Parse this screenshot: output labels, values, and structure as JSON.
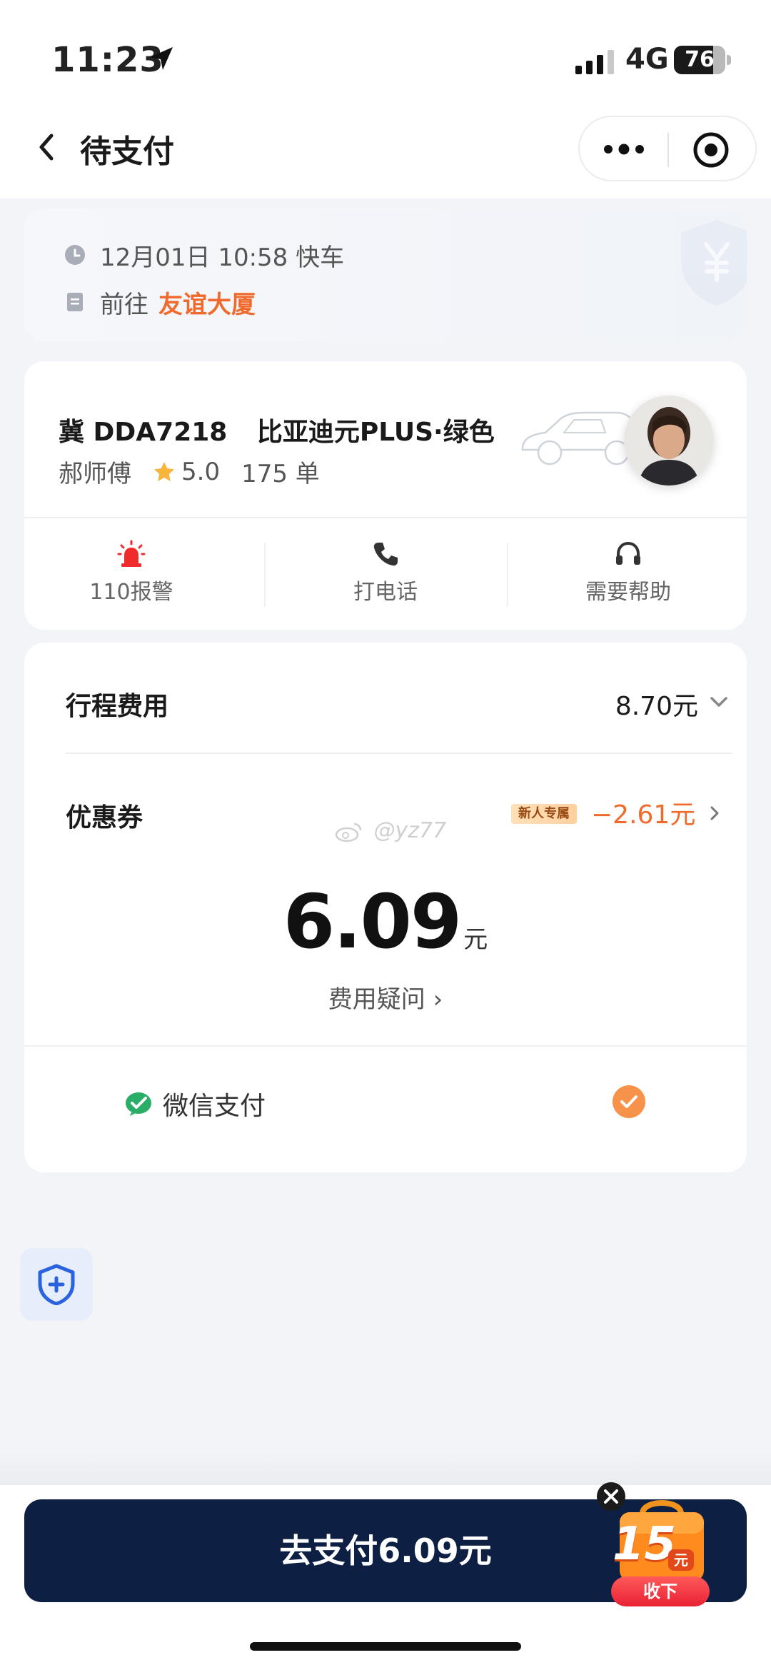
{
  "status_bar": {
    "time": "11:23",
    "network": "4G",
    "battery": "76",
    "battery_level": 0.76
  },
  "nav": {
    "title": "待支付"
  },
  "trip": {
    "datetime": "12月01日 10:58 快车",
    "dest_prefix": "前往",
    "destination": "友谊大厦"
  },
  "driver": {
    "plate": "冀 DDA7218",
    "car_model": "比亚迪元PLUS·绿色",
    "name": "郝师傅",
    "rating": "5.0",
    "orders": "175 单",
    "actions": [
      {
        "label": "110报警",
        "icon": "alarm-icon"
      },
      {
        "label": "打电话",
        "icon": "phone-icon"
      },
      {
        "label": "需要帮助",
        "icon": "headset-icon"
      }
    ]
  },
  "fee": {
    "trip_fee_label": "行程费用",
    "trip_fee_value": "8.70元",
    "coupon_label": "优惠券",
    "coupon_tag": "新人专属",
    "coupon_value": "−2.61元",
    "watermark": "@yz77",
    "total": "6.09",
    "total_unit": "元",
    "question": "费用疑问 ›",
    "payment_method": "微信支付"
  },
  "pay_button": {
    "label": "去支付6.09元"
  },
  "promo": {
    "amount": "15",
    "unit": "元",
    "action": "收下"
  },
  "colors": {
    "accent_orange": "#f06a2c",
    "pay_button_bg": "#0e1f44",
    "check_orange": "#f6924a",
    "wechat_green": "#2aae67"
  }
}
